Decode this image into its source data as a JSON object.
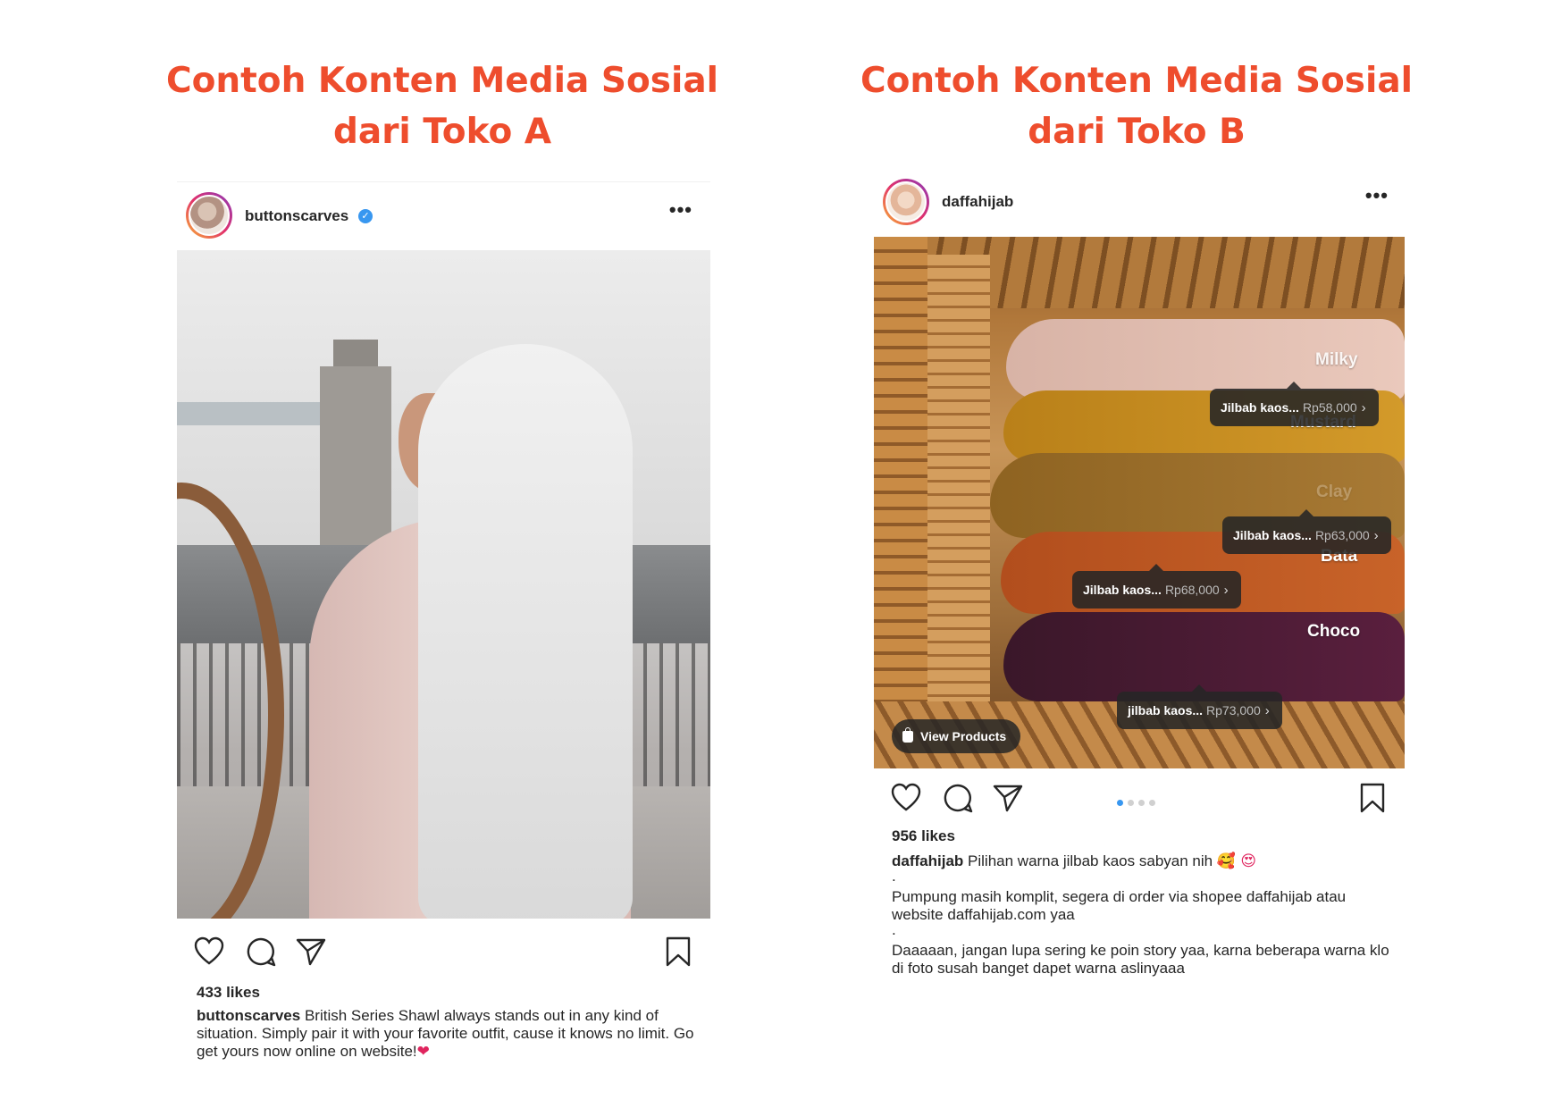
{
  "headings": {
    "toko_a": [
      "Contoh Konten Media Sosial",
      "dari Toko A"
    ],
    "toko_b": [
      "Contoh Konten Media Sosial",
      "dari Toko B"
    ]
  },
  "post_a": {
    "username": "buttonscarves",
    "verified": true,
    "likes": "433 likes",
    "caption_user": "buttonscarves",
    "caption_text": "British Series Shawl always stands out in any kind of situation. Simply pair it with your favorite outfit, cause it knows no limit. Go get yours now online on website!",
    "caption_emoji": "❤"
  },
  "post_b": {
    "username": "daffahijab",
    "color_labels": [
      "Milky",
      "Mustard",
      "Clay",
      "Bata",
      "Choco"
    ],
    "product_tags": [
      {
        "name": "Jilbab kaos...",
        "price": "Rp58,000"
      },
      {
        "name": "Jilbab kaos...",
        "price": "Rp63,000"
      },
      {
        "name": "Jilbab kaos...",
        "price": "Rp68,000"
      },
      {
        "name": "jilbab kaos...",
        "price": "Rp73,000"
      }
    ],
    "view_products_label": "View Products",
    "carousel": {
      "total": 4,
      "active": 1
    },
    "likes": "956 likes",
    "caption_user": "daffahijab",
    "caption_line1": "Pilihan warna jilbab kaos sabyan nih",
    "caption_emoji": "🥰 😍",
    "dot1": ".",
    "caption_line2": "Pumpung masih komplit, segera di order via shopee daffahijab atau website daffahijab.com yaa",
    "dot2": ".",
    "caption_line3": "Daaaaan, jangan lupa sering ke poin story yaa, karna beberapa warna klo di foto susah banget dapet warna aslinyaaa"
  },
  "icons": [
    "heart-icon",
    "comment-icon",
    "share-icon",
    "bookmark-icon",
    "more-icon",
    "verified-icon",
    "shopping-bag-icon"
  ],
  "colors": {
    "heading": "#ee4d2d",
    "verified": "#3897f0",
    "carousel_active": "#3897f0"
  }
}
